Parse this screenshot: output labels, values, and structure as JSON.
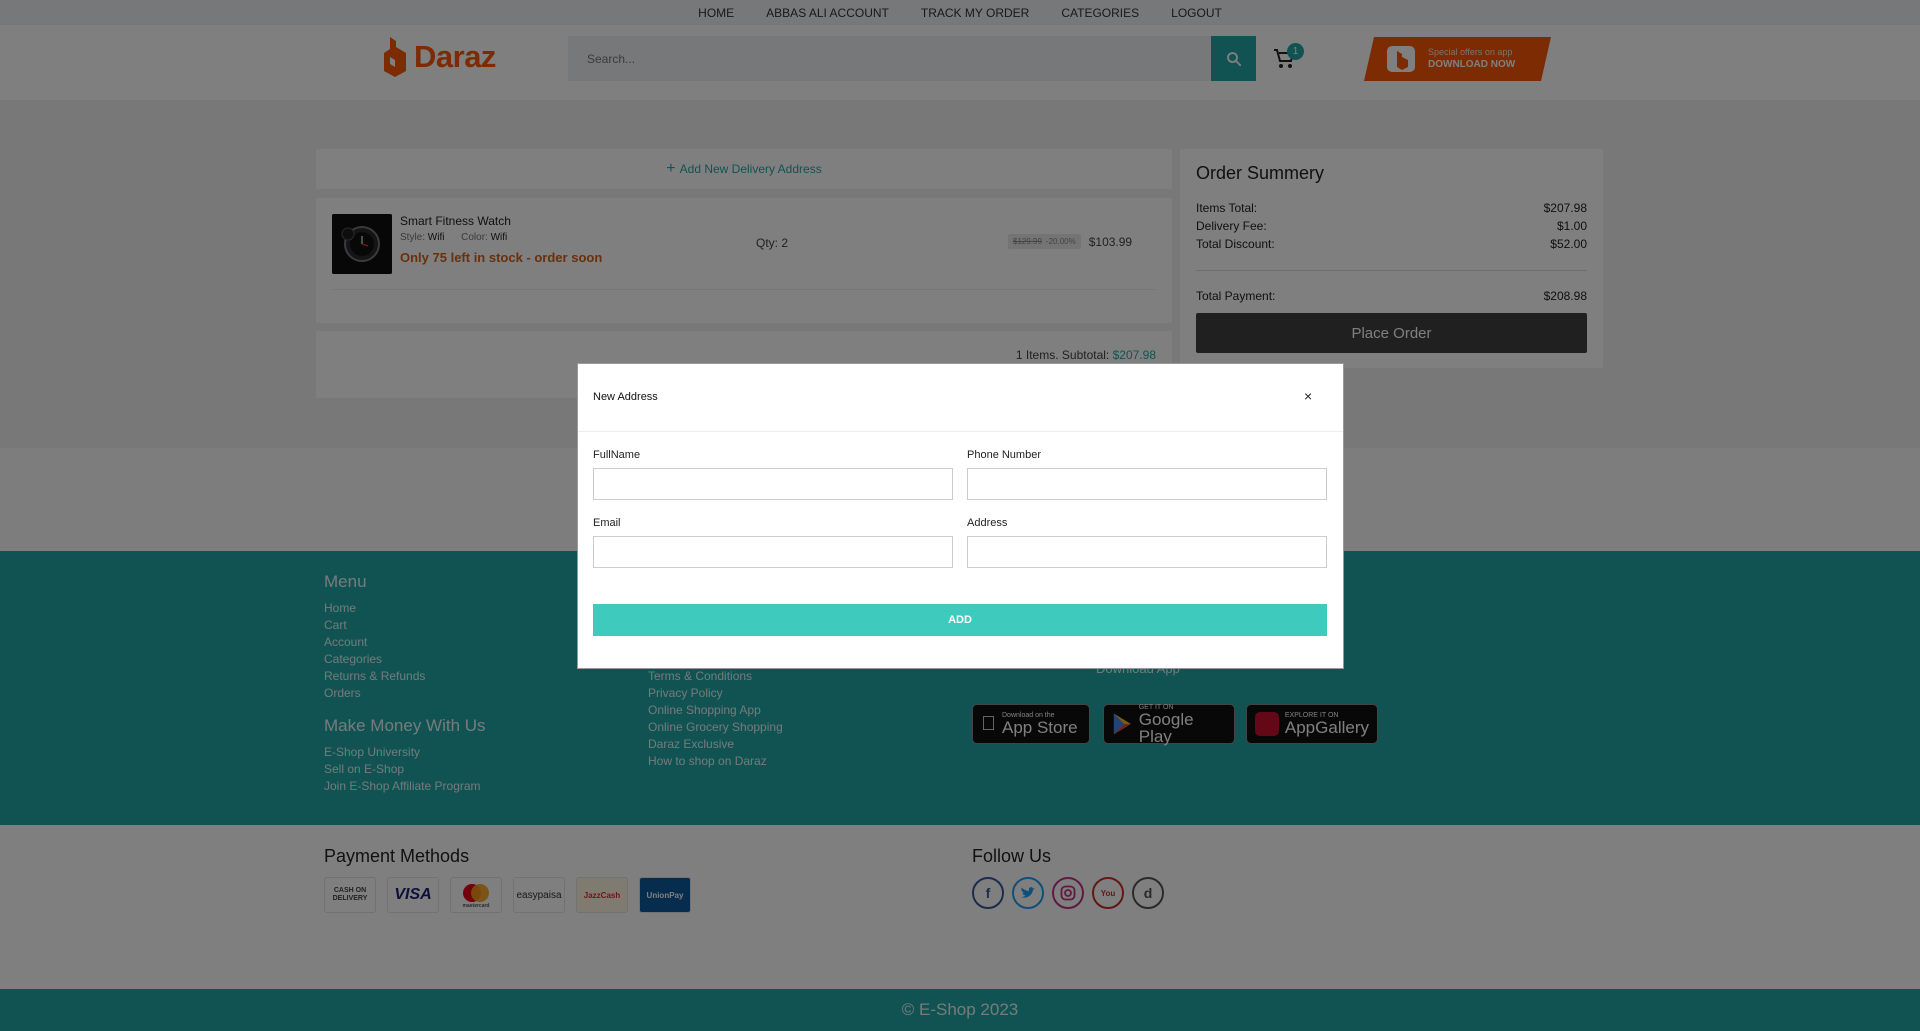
{
  "topnav": [
    "HOME",
    "ABBAS ALI ACCOUNT",
    "TRACK MY ORDER",
    "CATEGORIES",
    "LOGOUT"
  ],
  "header": {
    "logo_text": "Daraz",
    "search_placeholder": "Search...",
    "cart_count": "1",
    "app_banner": {
      "line1": "Special offers on app",
      "line2": "DOWNLOAD NOW"
    }
  },
  "main": {
    "add_address": "Add New Delivery Address",
    "item": {
      "name": "Smart Fitness Watch",
      "style_label": "Style:",
      "style_value": "Wifi",
      "color_label": "Color:",
      "color_value": "Wifi",
      "stock": "Only 75 left in stock - order soon",
      "qty": "Qty: 2",
      "old_price": "$129.99",
      "discount": "-20.00%",
      "price": "$103.99"
    },
    "subtotal_label": "1 Items. Subtotal:",
    "subtotal_value": "$207.98"
  },
  "summary": {
    "title": "Order Summery",
    "items_total_label": "Items Total:",
    "items_total": "$207.98",
    "delivery_label": "Delivery Fee:",
    "delivery": "$1.00",
    "discount_label": "Total Discount:",
    "discount": "$52.00",
    "payment_label": "Total Payment:",
    "payment": "$208.98",
    "button": "Place Order"
  },
  "footer": {
    "menu_title": "Menu",
    "menu": [
      "Home",
      "Cart",
      "Account",
      "Categories",
      "Returns & Refunds",
      "Orders"
    ],
    "money_title": "Make Money With Us",
    "money": [
      "E-Shop University",
      "Sell on E-Shop",
      "Join E-Shop Affiliate Program"
    ],
    "links": [
      "Terms & Conditions",
      "Privacy Policy",
      "Online Shopping App",
      "Online Grocery Shopping",
      "Daraz Exclusive",
      "How to shop on Daraz"
    ],
    "download_app": "Download App",
    "stores": [
      {
        "small": "Download on the",
        "big": "App Store"
      },
      {
        "small": "GET IT ON",
        "big": "Google Play"
      },
      {
        "small": "EXPLORE IT ON",
        "big": "AppGallery"
      }
    ],
    "payment_title": "Payment Methods",
    "payments": [
      "CASH ON DELIVERY",
      "VISA",
      "mastercard",
      "easypaisa",
      "JazzCash",
      "UnionPay"
    ],
    "follow_title": "Follow Us",
    "social": [
      "facebook-icon",
      "twitter-icon",
      "instagram-icon",
      "youtube-icon",
      "daraz-icon"
    ],
    "copyright": "© E-Shop 2023"
  },
  "modal": {
    "title": "New Address",
    "close": "×",
    "fullname_label": "FullName",
    "phone_label": "Phone Number",
    "email_label": "Email",
    "address_label": "Address",
    "add_button": "ADD"
  },
  "colors": {
    "accent": "#22a7a7",
    "brand": "#f85606",
    "button_teal": "#3ecbbd",
    "place_order": "#414141"
  }
}
